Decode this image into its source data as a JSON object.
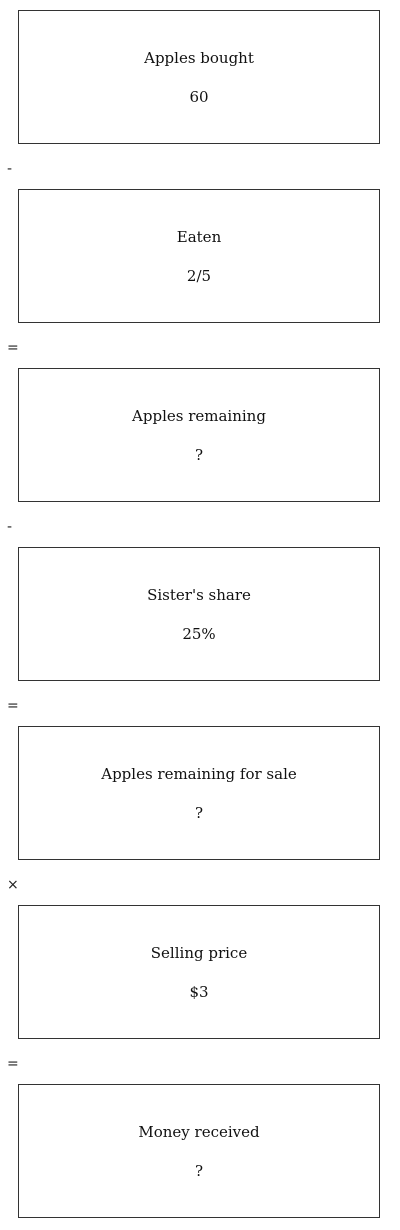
{
  "steps": [
    {
      "label": "Apples bought",
      "value": "60"
    },
    {
      "label": "Eaten",
      "value": "2/5"
    },
    {
      "label": "Apples remaining",
      "value": "?"
    },
    {
      "label": "Sister's share",
      "value": "25%"
    },
    {
      "label": "Apples remaining for sale",
      "value": "?"
    },
    {
      "label": "Selling price",
      "value": "$3"
    },
    {
      "label": "Money received",
      "value": "?"
    }
  ],
  "operators": [
    "-",
    "=",
    "-",
    "=",
    "×",
    "="
  ]
}
